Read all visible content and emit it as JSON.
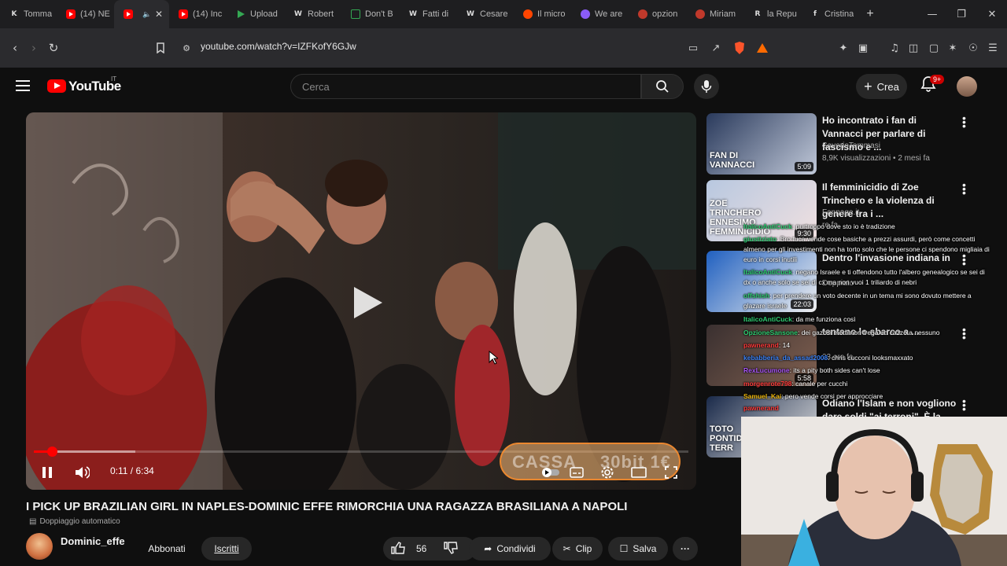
{
  "browser": {
    "tabs": [
      {
        "title": "Tomma",
        "favicon": "K",
        "color": "#53fc18",
        "fg": "#000"
      },
      {
        "title": "(14) NE",
        "favicon": "yt",
        "color": "#ff0000"
      },
      {
        "title": "",
        "favicon": "yt",
        "color": "#ff0000",
        "active": true
      },
      {
        "title": "(14) Inc",
        "favicon": "yt",
        "color": "#ff0000"
      },
      {
        "title": "Upload",
        "favicon": "play",
        "color": "#34a853"
      },
      {
        "title": "Robert",
        "favicon": "W",
        "color": "#ffffff",
        "fg": "#000"
      },
      {
        "title": "Don't B",
        "favicon": "doc",
        "color": "#34a853"
      },
      {
        "title": "Fatti di",
        "favicon": "W",
        "color": "#ffffff",
        "fg": "#000"
      },
      {
        "title": "Cesare",
        "favicon": "W",
        "color": "#ffffff",
        "fg": "#000"
      },
      {
        "title": "Il micro",
        "favicon": "reddit",
        "color": "#ff4500"
      },
      {
        "title": "We are",
        "favicon": "circle",
        "color": "#8b5cf6"
      },
      {
        "title": "opzion",
        "favicon": "circle",
        "color": "#c0392b"
      },
      {
        "title": "Miriam",
        "favicon": "circle",
        "color": "#c0392b"
      },
      {
        "title": "la Repu",
        "favicon": "R",
        "color": "#ffffff",
        "fg": "#000"
      },
      {
        "title": "Cristina",
        "favicon": "f",
        "color": "#ffffff",
        "fg": "#000"
      }
    ],
    "new_tab_glyph": "+",
    "url": "youtube.com/watch?v=IZFKofY6GJw"
  },
  "youtube": {
    "logo_text": "YouTube",
    "country_code": "IT",
    "search_placeholder": "Cerca",
    "create_label": "Crea",
    "notifications_badge": "9+"
  },
  "video": {
    "current_time": "0:11",
    "duration": "6:34",
    "time_display": "0:11 / 6:34",
    "played_fraction": 0.028,
    "buffered_fraction": 0.155,
    "overlay_left": "CASSA",
    "overlay_right": "30bit 1€",
    "title": "I PICK UP BRAZILIAN GIRL IN NAPLES-DOMINIC EFFE RIMORCHIA UNA RAGAZZA BRASILIANA A NAPOLI",
    "dubbing_label": "Doppiaggio automatico"
  },
  "channel": {
    "name": "Dominic_effe",
    "join_label": "Abbonati",
    "subscribed_label": "Iscritti"
  },
  "actions": {
    "likes": "56",
    "share_label": "Condividi",
    "clip_label": "Clip",
    "save_label": "Salva"
  },
  "recommendations": [
    {
      "title": "Ho incontrato i fan di Vannacci per parlare di fascismo e ...",
      "channel": "SaverioTommasi",
      "meta": "8,9K visualizzazioni • 2 mesi fa",
      "duration": "5:09",
      "thumb_text": "FAN DI VANNACCI"
    },
    {
      "title": "Il femminicidio di Zoe Trinchero e la violenza di genere tra i ...",
      "channel": "Fanpage.it",
      "meta": "re fa",
      "duration": "9:30",
      "thumb_text": "ZOE TRINCHERO ENNESIMO FEMMINICIDIO"
    },
    {
      "title": "Dentro l'invasione indiana in",
      "channel": "",
      "meta": "Doppiato",
      "duration": "22:03",
      "thumb_text": ""
    },
    {
      "title": "tentano lo sbarco a ...",
      "channel": "",
      "meta": "23 ore fa",
      "duration": "5:58",
      "thumb_text": ""
    },
    {
      "title": "Odiano l'Islam e non vogliono dare soldi \"ai terroni\". È la ...",
      "channel": "",
      "meta": "",
      "duration": "",
      "thumb_text": "TOTO PONTIDA TERR"
    }
  ],
  "chat": [
    {
      "user": "ItalicoAntiCuck",
      "color": "#2ecc71",
      "text": ": purtroppo dove sto io è tradizione"
    },
    {
      "user": "giustiziato",
      "color": "#2ecc71",
      "text": ": Bro tuca vende cose basiche a prezzi assurdi, però come concetti"
    },
    {
      "user": "",
      "color": "#ffffff",
      "text": "almeno per gli investimenti non ha torto solo che le persone ci spendono migliaia di"
    },
    {
      "user": "",
      "color": "#ffffff",
      "text": "euro in corsi inutili"
    },
    {
      "user": "ItalicoAntiCuck",
      "color": "#2ecc71",
      "text": ": negano Israele e ti offendono tutto l'albero genealogico se sei di"
    },
    {
      "user": "",
      "color": "#ffffff",
      "text": "dx o anche solo se sei di cx ma non vuoi 1 triliardo di nebri"
    },
    {
      "user": "offshish",
      "color": "#2ecc71",
      "text": ": per prendere un voto decente in un tema mi sono dovuto mettere a"
    },
    {
      "user": "",
      "color": "#ffffff",
      "text": "glazare israele"
    },
    {
      "user": "ItalicoAntiCuck",
      "color": "#2ecc71",
      "text": ": da me funziona così"
    },
    {
      "user": "OpzioneSansone",
      "color": "#2ecc71",
      "text": ": dei gazosi morti non frega un cazzo a nessuno"
    },
    {
      "user": "pawnerand",
      "color": "#ff3b3b",
      "text": ": 14"
    },
    {
      "user": "kebabberia_da_assad2008",
      "color": "#3b82f6",
      "text": ": chris cucconi looksmaxxato"
    },
    {
      "user": "RexLucumone",
      "color": "#a855f7",
      "text": ": its a pity both sides can't lose"
    },
    {
      "user": "morgenrote798",
      "color": "#ff3b3b",
      "text": ": canale per cucchi"
    },
    {
      "user": "Samuel_Kai",
      "color": "#eab308",
      "text": ": pero vende corsi per approcciare"
    },
    {
      "user": "pawnerand",
      "color": "#ff3b3b",
      "text": ""
    }
  ]
}
